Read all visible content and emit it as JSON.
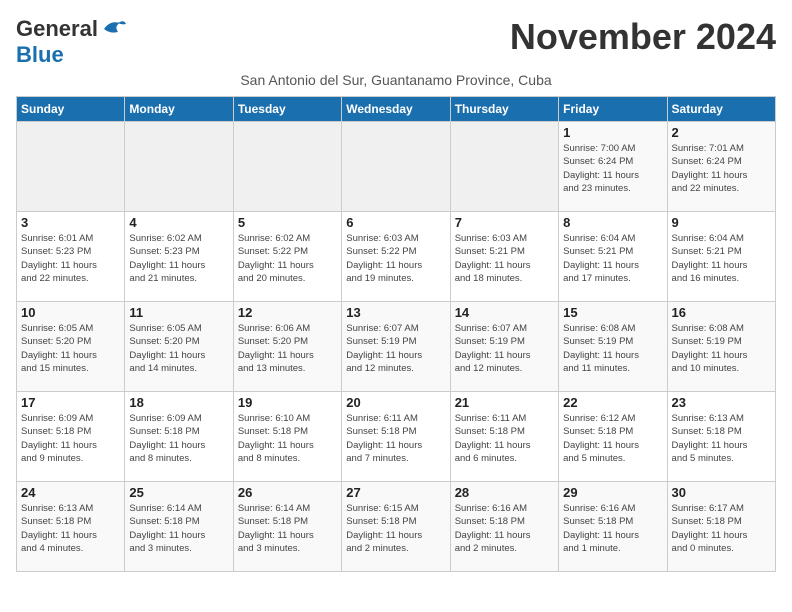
{
  "logo": {
    "general": "General",
    "blue": "Blue"
  },
  "title": "November 2024",
  "subtitle": "San Antonio del Sur, Guantanamo Province, Cuba",
  "days_of_week": [
    "Sunday",
    "Monday",
    "Tuesday",
    "Wednesday",
    "Thursday",
    "Friday",
    "Saturday"
  ],
  "weeks": [
    [
      {
        "day": "",
        "info": ""
      },
      {
        "day": "",
        "info": ""
      },
      {
        "day": "",
        "info": ""
      },
      {
        "day": "",
        "info": ""
      },
      {
        "day": "",
        "info": ""
      },
      {
        "day": "1",
        "info": "Sunrise: 7:00 AM\nSunset: 6:24 PM\nDaylight: 11 hours\nand 23 minutes."
      },
      {
        "day": "2",
        "info": "Sunrise: 7:01 AM\nSunset: 6:24 PM\nDaylight: 11 hours\nand 22 minutes."
      }
    ],
    [
      {
        "day": "3",
        "info": "Sunrise: 6:01 AM\nSunset: 5:23 PM\nDaylight: 11 hours\nand 22 minutes."
      },
      {
        "day": "4",
        "info": "Sunrise: 6:02 AM\nSunset: 5:23 PM\nDaylight: 11 hours\nand 21 minutes."
      },
      {
        "day": "5",
        "info": "Sunrise: 6:02 AM\nSunset: 5:22 PM\nDaylight: 11 hours\nand 20 minutes."
      },
      {
        "day": "6",
        "info": "Sunrise: 6:03 AM\nSunset: 5:22 PM\nDaylight: 11 hours\nand 19 minutes."
      },
      {
        "day": "7",
        "info": "Sunrise: 6:03 AM\nSunset: 5:21 PM\nDaylight: 11 hours\nand 18 minutes."
      },
      {
        "day": "8",
        "info": "Sunrise: 6:04 AM\nSunset: 5:21 PM\nDaylight: 11 hours\nand 17 minutes."
      },
      {
        "day": "9",
        "info": "Sunrise: 6:04 AM\nSunset: 5:21 PM\nDaylight: 11 hours\nand 16 minutes."
      }
    ],
    [
      {
        "day": "10",
        "info": "Sunrise: 6:05 AM\nSunset: 5:20 PM\nDaylight: 11 hours\nand 15 minutes."
      },
      {
        "day": "11",
        "info": "Sunrise: 6:05 AM\nSunset: 5:20 PM\nDaylight: 11 hours\nand 14 minutes."
      },
      {
        "day": "12",
        "info": "Sunrise: 6:06 AM\nSunset: 5:20 PM\nDaylight: 11 hours\nand 13 minutes."
      },
      {
        "day": "13",
        "info": "Sunrise: 6:07 AM\nSunset: 5:19 PM\nDaylight: 11 hours\nand 12 minutes."
      },
      {
        "day": "14",
        "info": "Sunrise: 6:07 AM\nSunset: 5:19 PM\nDaylight: 11 hours\nand 12 minutes."
      },
      {
        "day": "15",
        "info": "Sunrise: 6:08 AM\nSunset: 5:19 PM\nDaylight: 11 hours\nand 11 minutes."
      },
      {
        "day": "16",
        "info": "Sunrise: 6:08 AM\nSunset: 5:19 PM\nDaylight: 11 hours\nand 10 minutes."
      }
    ],
    [
      {
        "day": "17",
        "info": "Sunrise: 6:09 AM\nSunset: 5:18 PM\nDaylight: 11 hours\nand 9 minutes."
      },
      {
        "day": "18",
        "info": "Sunrise: 6:09 AM\nSunset: 5:18 PM\nDaylight: 11 hours\nand 8 minutes."
      },
      {
        "day": "19",
        "info": "Sunrise: 6:10 AM\nSunset: 5:18 PM\nDaylight: 11 hours\nand 8 minutes."
      },
      {
        "day": "20",
        "info": "Sunrise: 6:11 AM\nSunset: 5:18 PM\nDaylight: 11 hours\nand 7 minutes."
      },
      {
        "day": "21",
        "info": "Sunrise: 6:11 AM\nSunset: 5:18 PM\nDaylight: 11 hours\nand 6 minutes."
      },
      {
        "day": "22",
        "info": "Sunrise: 6:12 AM\nSunset: 5:18 PM\nDaylight: 11 hours\nand 5 minutes."
      },
      {
        "day": "23",
        "info": "Sunrise: 6:13 AM\nSunset: 5:18 PM\nDaylight: 11 hours\nand 5 minutes."
      }
    ],
    [
      {
        "day": "24",
        "info": "Sunrise: 6:13 AM\nSunset: 5:18 PM\nDaylight: 11 hours\nand 4 minutes."
      },
      {
        "day": "25",
        "info": "Sunrise: 6:14 AM\nSunset: 5:18 PM\nDaylight: 11 hours\nand 3 minutes."
      },
      {
        "day": "26",
        "info": "Sunrise: 6:14 AM\nSunset: 5:18 PM\nDaylight: 11 hours\nand 3 minutes."
      },
      {
        "day": "27",
        "info": "Sunrise: 6:15 AM\nSunset: 5:18 PM\nDaylight: 11 hours\nand 2 minutes."
      },
      {
        "day": "28",
        "info": "Sunrise: 6:16 AM\nSunset: 5:18 PM\nDaylight: 11 hours\nand 2 minutes."
      },
      {
        "day": "29",
        "info": "Sunrise: 6:16 AM\nSunset: 5:18 PM\nDaylight: 11 hours\nand 1 minute."
      },
      {
        "day": "30",
        "info": "Sunrise: 6:17 AM\nSunset: 5:18 PM\nDaylight: 11 hours\nand 0 minutes."
      }
    ]
  ]
}
